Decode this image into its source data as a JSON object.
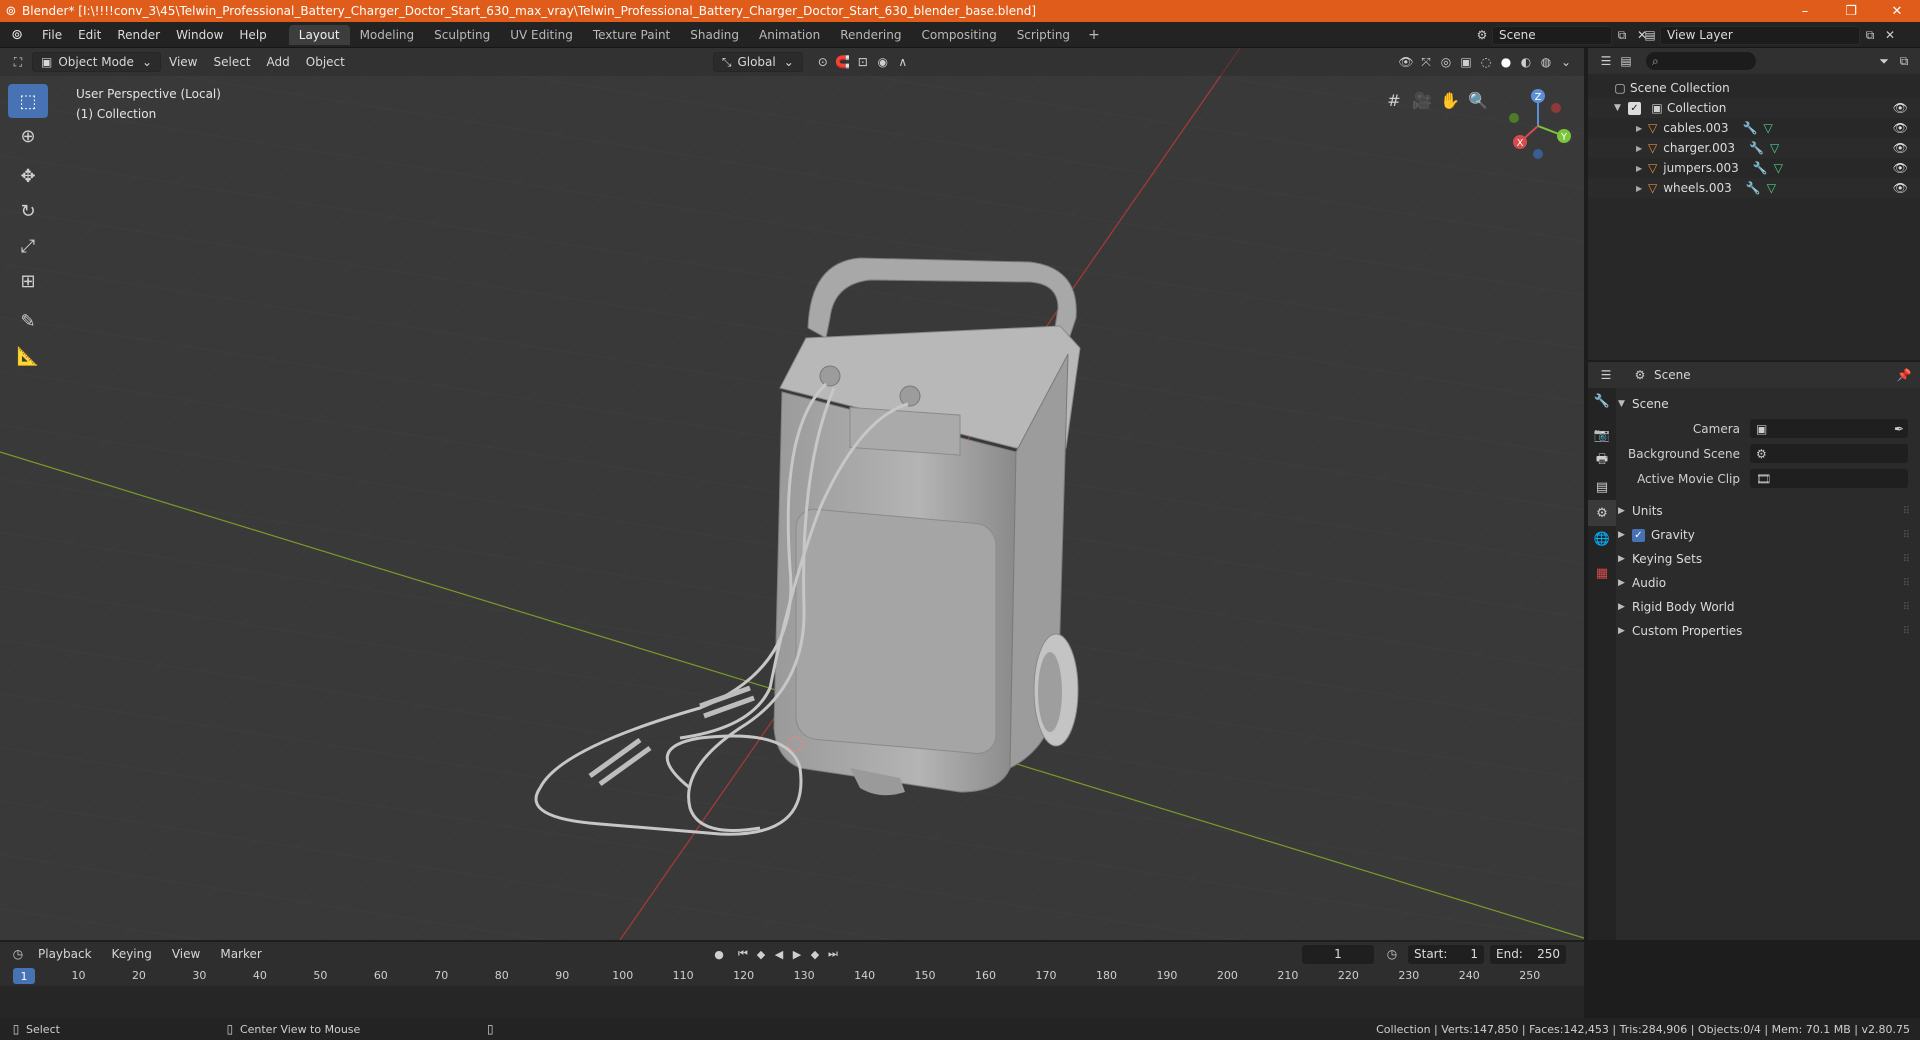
{
  "window": {
    "title": "Blender* [I:\\!!!!conv_3\\45\\Telwin_Professional_Battery_Charger_Doctor_Start_630_max_vray\\Telwin_Professional_Battery_Charger_Doctor_Start_630_blender_base.blend]"
  },
  "menu": [
    "File",
    "Edit",
    "Render",
    "Window",
    "Help"
  ],
  "workspaces": [
    "Layout",
    "Modeling",
    "Sculpting",
    "UV Editing",
    "Texture Paint",
    "Shading",
    "Animation",
    "Rendering",
    "Compositing",
    "Scripting"
  ],
  "active_workspace": "Layout",
  "scene_name": "Scene",
  "view_layer": "View Layer",
  "viewport": {
    "mode": "Object Mode",
    "menus": [
      "View",
      "Select",
      "Add",
      "Object"
    ],
    "orientation": "Global",
    "info_line1": "User Perspective (Local)",
    "info_line2": "(1) Collection",
    "gizmo": {
      "z": "Z",
      "y": "Y",
      "x": "X"
    }
  },
  "outliner": {
    "root": "Scene Collection",
    "collection": "Collection",
    "objects": [
      "cables.003",
      "charger.003",
      "jumpers.003",
      "wheels.003"
    ]
  },
  "properties": {
    "header": "Scene",
    "section": "Scene",
    "fields": [
      {
        "label": "Camera",
        "value": ""
      },
      {
        "label": "Background Scene",
        "value": ""
      },
      {
        "label": "Active Movie Clip",
        "value": ""
      }
    ],
    "panels": [
      "Units",
      "Gravity",
      "Keying Sets",
      "Audio",
      "Rigid Body World",
      "Custom Properties"
    ],
    "gravity_checked": true
  },
  "timeline": {
    "menus": [
      "Playback",
      "Keying",
      "View",
      "Marker"
    ],
    "current_frame": "1",
    "start_label": "Start:",
    "start": "1",
    "end_label": "End:",
    "end": "250",
    "ruler": [
      "10",
      "20",
      "30",
      "40",
      "50",
      "60",
      "70",
      "80",
      "90",
      "100",
      "110",
      "120",
      "130",
      "140",
      "150",
      "160",
      "170",
      "180",
      "190",
      "200",
      "210",
      "220",
      "230",
      "240",
      "250"
    ],
    "playhead_label": "1"
  },
  "status": {
    "left": "Select",
    "middle": "Center View to Mouse",
    "stats": "Collection | Verts:147,850 | Faces:142,453 | Tris:284,906 | Objects:0/4 | Mem: 70.1 MB | v2.80.75"
  }
}
